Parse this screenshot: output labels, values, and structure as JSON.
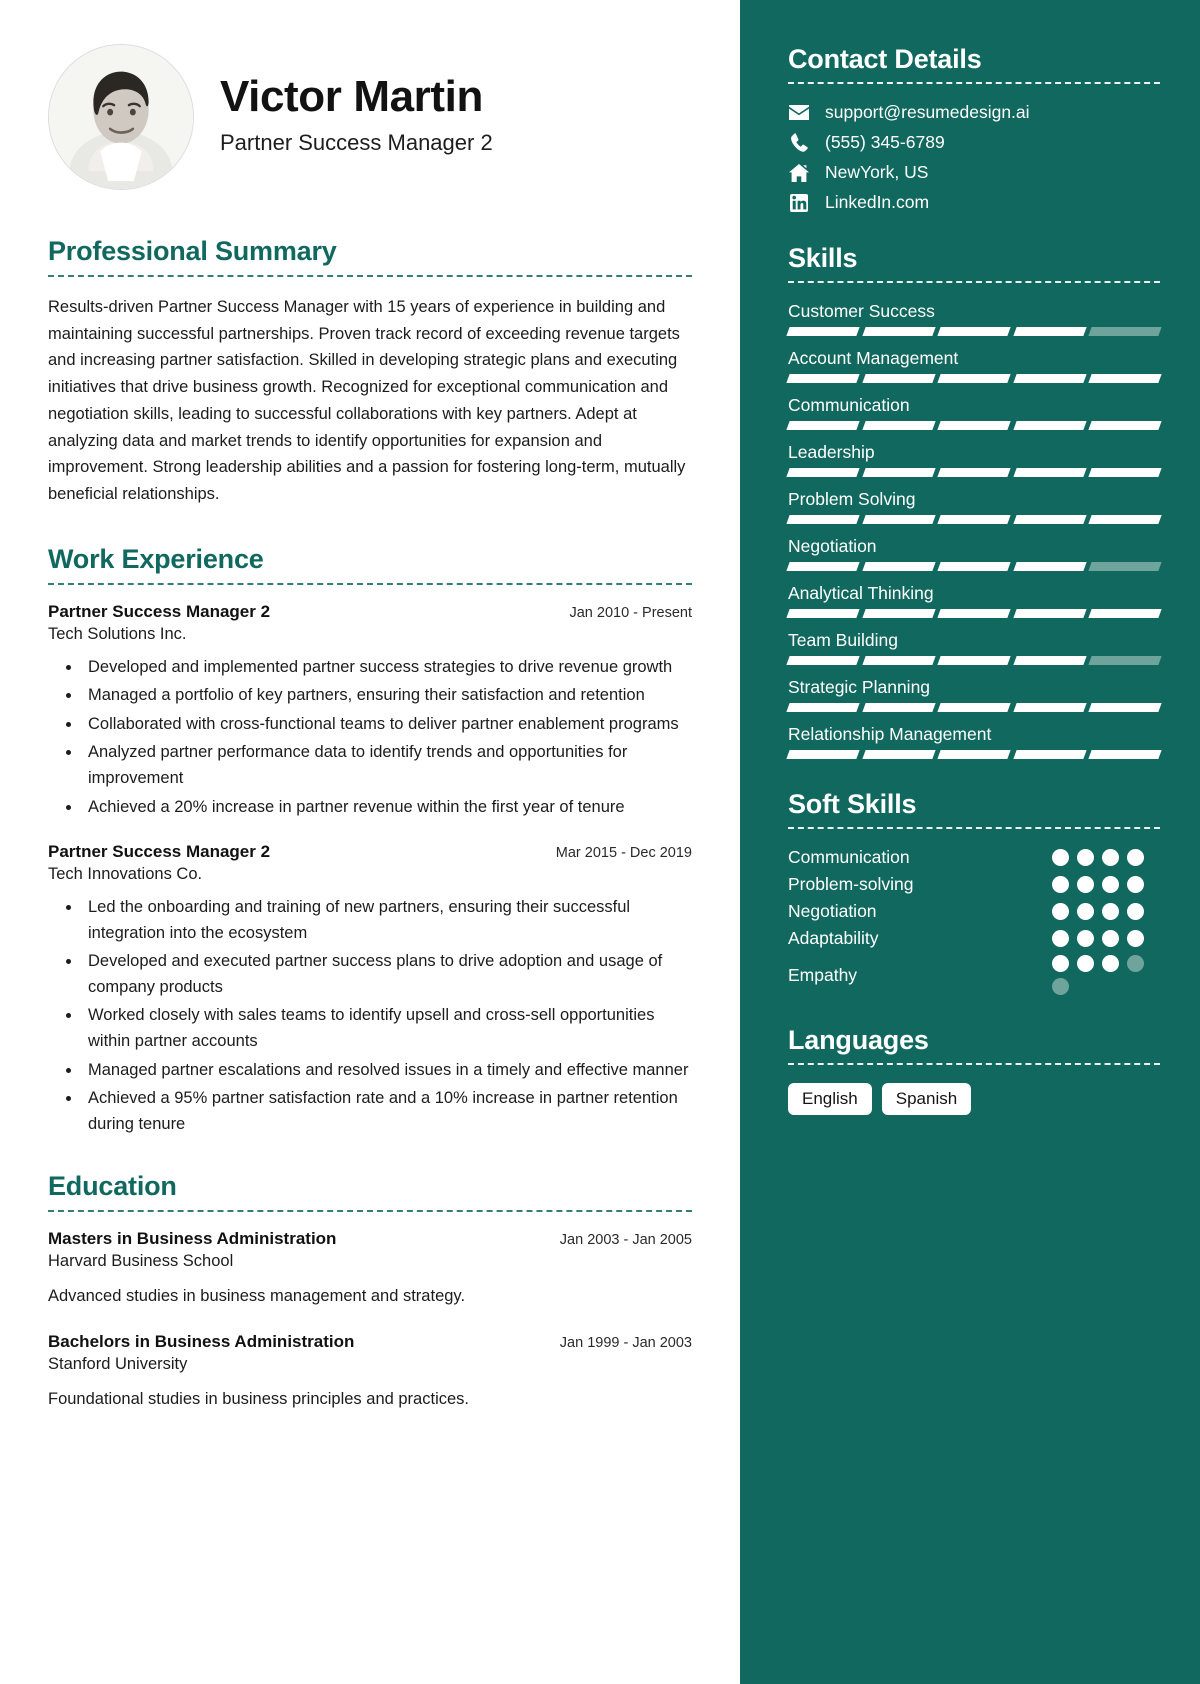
{
  "theme": {
    "accent": "#11685F",
    "sidebar_bg": "#11685F",
    "bar_on": "#ffffff",
    "bar_off": "#6ea49c"
  },
  "header": {
    "name": "Victor Martin",
    "role": "Partner Success Manager 2",
    "avatar_alt": "profile-photo"
  },
  "summary": {
    "title": "Professional Summary",
    "text": "Results-driven Partner Success Manager with 15 years of experience in building and maintaining successful partnerships. Proven track record of exceeding revenue targets and increasing partner satisfaction. Skilled in developing strategic plans and executing initiatives that drive business growth. Recognized for exceptional communication and negotiation skills, leading to successful collaborations with key partners. Adept at analyzing data and market trends to identify opportunities for expansion and improvement. Strong leadership abilities and a passion for fostering long-term, mutually beneficial relationships."
  },
  "work": {
    "title": "Work Experience",
    "entries": [
      {
        "job_title": "Partner Success Manager 2",
        "date": "Jan 2010 - Present",
        "company": "Tech Solutions Inc.",
        "bullets": [
          "Developed and implemented partner success strategies to drive revenue growth",
          "Managed a portfolio of key partners, ensuring their satisfaction and retention",
          "Collaborated with cross-functional teams to deliver partner enablement programs",
          "Analyzed partner performance data to identify trends and opportunities for improvement",
          "Achieved a 20% increase in partner revenue within the first year of tenure"
        ]
      },
      {
        "job_title": "Partner Success Manager 2",
        "date": "Mar 2015 - Dec 2019",
        "company": "Tech Innovations Co.",
        "bullets": [
          "Led the onboarding and training of new partners, ensuring their successful integration into the ecosystem",
          "Developed and executed partner success plans to drive adoption and usage of company products",
          "Worked closely with sales teams to identify upsell and cross-sell opportunities within partner accounts",
          "Managed partner escalations and resolved issues in a timely and effective manner",
          "Achieved a 95% partner satisfaction rate and a 10% increase in partner retention during tenure"
        ]
      }
    ]
  },
  "education": {
    "title": "Education",
    "entries": [
      {
        "degree": "Masters in Business Administration",
        "date": "Jan 2003 - Jan 2005",
        "school": "Harvard Business School",
        "description": "Advanced studies in business management and strategy."
      },
      {
        "degree": "Bachelors in Business Administration",
        "date": "Jan 1999 - Jan 2003",
        "school": "Stanford University",
        "description": "Foundational studies in business principles and practices."
      }
    ]
  },
  "contact": {
    "title": "Contact Details",
    "items": [
      {
        "icon": "envelope-icon",
        "value": "support@resumedesign.ai"
      },
      {
        "icon": "phone-icon",
        "value": "(555) 345-6789"
      },
      {
        "icon": "home-icon",
        "value": "NewYork, US"
      },
      {
        "icon": "linkedin-icon",
        "value": "LinkedIn.com"
      }
    ]
  },
  "skills": {
    "title": "Skills",
    "max": 5,
    "items": [
      {
        "name": "Customer Success",
        "level": 4
      },
      {
        "name": "Account Management",
        "level": 5
      },
      {
        "name": "Communication",
        "level": 5
      },
      {
        "name": "Leadership",
        "level": 5
      },
      {
        "name": "Problem Solving",
        "level": 5
      },
      {
        "name": "Negotiation",
        "level": 4
      },
      {
        "name": "Analytical Thinking",
        "level": 5
      },
      {
        "name": "Team Building",
        "level": 4
      },
      {
        "name": "Strategic Planning",
        "level": 5
      },
      {
        "name": "Relationship Management",
        "level": 5
      }
    ]
  },
  "soft_skills": {
    "title": "Soft Skills",
    "max": 4,
    "items": [
      {
        "name": "Communication",
        "level": 4
      },
      {
        "name": "Problem-solving",
        "level": 4
      },
      {
        "name": "Negotiation",
        "level": 4
      },
      {
        "name": "Adaptability",
        "level": 4
      },
      {
        "name": "Empathy",
        "level": 3,
        "dots": 5
      }
    ]
  },
  "languages": {
    "title": "Languages",
    "items": [
      "English",
      "Spanish"
    ]
  }
}
